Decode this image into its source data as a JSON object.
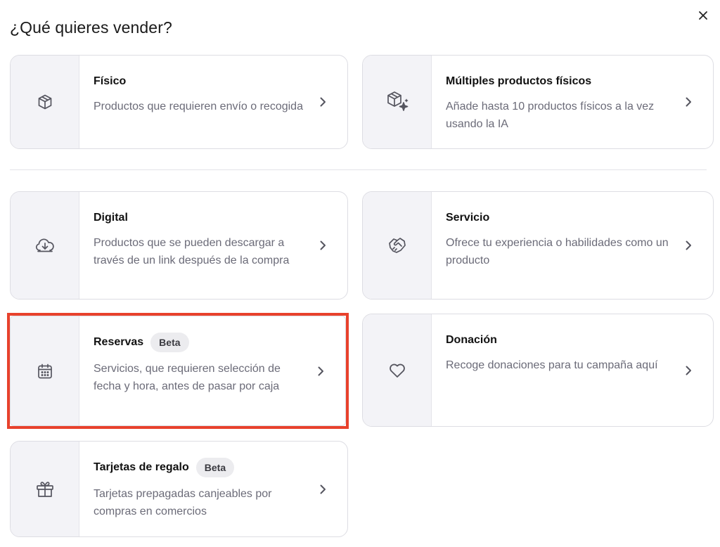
{
  "header": {
    "title": "¿Qué quieres vender?"
  },
  "cards": {
    "fisico": {
      "title": "Físico",
      "desc": "Productos que requieren envío o recogida"
    },
    "multiples": {
      "title": "Múltiples productos físicos",
      "desc": "Añade hasta 10 productos físicos a la vez usando la IA"
    },
    "digital": {
      "title": "Digital",
      "desc": "Productos que se pueden descargar a través de un link después de la compra"
    },
    "servicio": {
      "title": "Servicio",
      "desc": "Ofrece tu experiencia o habilidades como un producto"
    },
    "reservas": {
      "title": "Reservas",
      "badge": "Beta",
      "desc": "Servicios, que requieren selección de fecha y hora, antes de pasar por caja"
    },
    "donacion": {
      "title": "Donación",
      "desc": "Recoge donaciones para tu campaña aquí"
    },
    "tarjetas": {
      "title": "Tarjetas de regalo",
      "badge": "Beta",
      "desc": "Tarjetas prepagadas canjeables por compras en comercios"
    }
  },
  "icons": {
    "fisico": "package-icon",
    "multiples": "package-sparkle-icon",
    "digital": "cloud-download-icon",
    "servicio": "handshake-icon",
    "reservas": "calendar-icon",
    "donacion": "heart-icon",
    "tarjetas": "gift-icon",
    "close": "close-icon",
    "chevron": "chevron-right-icon"
  },
  "colors": {
    "highlight": "#e8412c",
    "icon_panel": "#f3f3f7",
    "badge_bg": "#ececef",
    "text_secondary": "#6b6b78"
  }
}
